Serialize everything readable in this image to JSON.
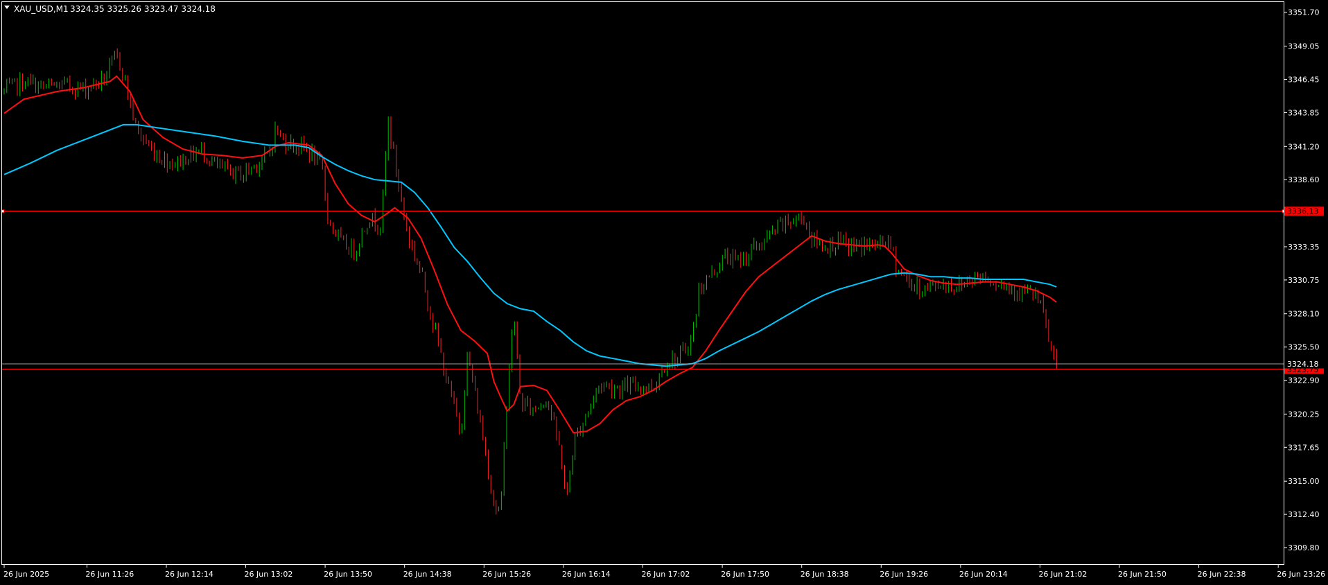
{
  "window": {
    "symbol_label": "XAU_USD,M1",
    "ohlc_label": "3324.35 3325.26 3323.47 3324.18"
  },
  "colors": {
    "background": "#000000",
    "frame": "#ffffff",
    "axis_text": "#ffffff",
    "bull_candle": "#00c000",
    "bear_candle": "#ff2020",
    "ma_fast": "#ff1010",
    "ma_slow": "#00c8ff",
    "level_line": "#ff0000",
    "bid_line": "#a0a0a0",
    "tag_bg": "#ff0000",
    "tag_text": "#000000"
  },
  "chart_data": {
    "type": "candlestick",
    "symbol": "XAU_USD",
    "timeframe": "M1",
    "ylim": [
      3308.5,
      3352.5
    ],
    "y_ticks": [
      "3351.70",
      "3349.05",
      "3346.45",
      "3343.85",
      "3341.20",
      "3338.60",
      "3336.00",
      "3333.35",
      "3330.75",
      "3328.10",
      "3325.50",
      "3322.90",
      "3320.25",
      "3317.65",
      "3315.00",
      "3312.40",
      "3309.80"
    ],
    "x_labels": [
      "26 Jun 2025",
      "26 Jun 11:26",
      "26 Jun 12:14",
      "26 Jun 13:02",
      "26 Jun 13:50",
      "26 Jun 14:38",
      "26 Jun 15:26",
      "26 Jun 16:14",
      "26 Jun 17:02",
      "26 Jun 17:50",
      "26 Jun 18:38",
      "26 Jun 19:26",
      "26 Jun 20:14",
      "26 Jun 21:02",
      "26 Jun 21:50",
      "26 Jun 22:38",
      "26 Jun 23:26"
    ],
    "price_path": [
      [
        0,
        3345.5
      ],
      [
        3,
        3346.3
      ],
      [
        6,
        3345.8
      ],
      [
        9,
        3346.0
      ],
      [
        12,
        3345.7
      ],
      [
        15,
        3346.4
      ],
      [
        17,
        3348.3
      ],
      [
        18,
        3347.0
      ],
      [
        19,
        3344.6
      ],
      [
        20,
        3342.5
      ],
      [
        22,
        3341.1
      ],
      [
        24,
        3340.2
      ],
      [
        26,
        3339.9
      ],
      [
        28,
        3340.5
      ],
      [
        30,
        3340.9
      ],
      [
        32,
        3339.6
      ],
      [
        34,
        3339.2
      ],
      [
        36,
        3339.0
      ],
      [
        38,
        3339.8
      ],
      [
        40,
        3340.5
      ],
      [
        41,
        3342.6
      ],
      [
        42,
        3341.7
      ],
      [
        44,
        3341.3
      ],
      [
        46,
        3340.9
      ],
      [
        48,
        3339.5
      ],
      [
        49,
        3335.4
      ],
      [
        51,
        3333.6
      ],
      [
        53,
        3333.0
      ],
      [
        55,
        3335.6
      ],
      [
        57,
        3335.1
      ],
      [
        58,
        3343.3
      ],
      [
        59,
        3340.0
      ],
      [
        61,
        3334.2
      ],
      [
        63,
        3331.3
      ],
      [
        65,
        3327.0
      ],
      [
        67,
        3322.6
      ],
      [
        69,
        3318.9
      ],
      [
        70,
        3324.9
      ],
      [
        72,
        3319.5
      ],
      [
        74,
        3313.2
      ],
      [
        75,
        3312.4
      ],
      [
        76,
        3322.1
      ],
      [
        77,
        3328.1
      ],
      [
        78,
        3321.1
      ],
      [
        80,
        3320.6
      ],
      [
        82,
        3321.6
      ],
      [
        84,
        3317.4
      ],
      [
        85,
        3313.5
      ],
      [
        86,
        3318.0
      ],
      [
        88,
        3320.3
      ],
      [
        90,
        3322.6
      ],
      [
        93,
        3322.3
      ],
      [
        96,
        3322.5
      ],
      [
        98,
        3322.3
      ],
      [
        100,
        3324.4
      ],
      [
        102,
        3324.6
      ],
      [
        104,
        3326.3
      ],
      [
        105,
        3330.1
      ],
      [
        107,
        3331.3
      ],
      [
        109,
        3332.6
      ],
      [
        111,
        3332.2
      ],
      [
        113,
        3333.1
      ],
      [
        115,
        3333.8
      ],
      [
        117,
        3334.9
      ],
      [
        119,
        3335.4
      ],
      [
        121,
        3335.6
      ],
      [
        122,
        3333.9
      ],
      [
        124,
        3333.4
      ],
      [
        126,
        3333.7
      ],
      [
        128,
        3333.3
      ],
      [
        130,
        3333.5
      ],
      [
        132,
        3333.4
      ],
      [
        133,
        3333.9
      ],
      [
        134,
        3333.2
      ],
      [
        135,
        3331.6
      ],
      [
        136,
        3331.0
      ],
      [
        138,
        3330.0
      ],
      [
        140,
        3330.2
      ],
      [
        142,
        3330.5
      ],
      [
        144,
        3330.2
      ],
      [
        146,
        3330.9
      ],
      [
        148,
        3331.1
      ],
      [
        150,
        3330.6
      ],
      [
        152,
        3330.2
      ],
      [
        154,
        3329.8
      ],
      [
        156,
        3329.5
      ],
      [
        157,
        3328.0
      ],
      [
        158,
        3325.6
      ],
      [
        159,
        3324.18
      ]
    ],
    "series": [
      {
        "name": "",
        "role": "fast moving average",
        "color": "#ff1010",
        "points": [
          [
            0,
            3343.8
          ],
          [
            3,
            3344.9
          ],
          [
            8,
            3345.5
          ],
          [
            12,
            3345.8
          ],
          [
            16,
            3346.3
          ],
          [
            17,
            3346.7
          ],
          [
            19,
            3345.5
          ],
          [
            21,
            3343.3
          ],
          [
            24,
            3341.9
          ],
          [
            27,
            3341.0
          ],
          [
            30,
            3340.6
          ],
          [
            33,
            3340.5
          ],
          [
            36,
            3340.3
          ],
          [
            39,
            3340.5
          ],
          [
            41,
            3341.2
          ],
          [
            43,
            3341.5
          ],
          [
            46,
            3341.3
          ],
          [
            48,
            3340.5
          ],
          [
            50,
            3338.3
          ],
          [
            52,
            3336.7
          ],
          [
            54,
            3335.8
          ],
          [
            56,
            3335.3
          ],
          [
            58,
            3336.0
          ],
          [
            59,
            3336.4
          ],
          [
            61,
            3335.6
          ],
          [
            63,
            3334.0
          ],
          [
            65,
            3331.5
          ],
          [
            67,
            3328.8
          ],
          [
            69,
            3326.8
          ],
          [
            71,
            3326.0
          ],
          [
            73,
            3325.0
          ],
          [
            74,
            3322.8
          ],
          [
            75,
            3321.6
          ],
          [
            76,
            3320.5
          ],
          [
            77,
            3321.0
          ],
          [
            78,
            3322.4
          ],
          [
            80,
            3322.5
          ],
          [
            82,
            3322.1
          ],
          [
            84,
            3320.5
          ],
          [
            86,
            3318.8
          ],
          [
            88,
            3318.9
          ],
          [
            90,
            3319.5
          ],
          [
            92,
            3320.6
          ],
          [
            94,
            3321.3
          ],
          [
            96,
            3321.6
          ],
          [
            98,
            3322.1
          ],
          [
            100,
            3322.8
          ],
          [
            102,
            3323.4
          ],
          [
            104,
            3323.9
          ],
          [
            106,
            3325.2
          ],
          [
            108,
            3326.8
          ],
          [
            110,
            3328.3
          ],
          [
            112,
            3329.8
          ],
          [
            114,
            3331.0
          ],
          [
            116,
            3331.8
          ],
          [
            118,
            3332.6
          ],
          [
            120,
            3333.4
          ],
          [
            122,
            3334.2
          ],
          [
            124,
            3333.8
          ],
          [
            126,
            3333.6
          ],
          [
            128,
            3333.5
          ],
          [
            130,
            3333.4
          ],
          [
            132,
            3333.5
          ],
          [
            133,
            3333.4
          ],
          [
            134,
            3332.9
          ],
          [
            136,
            3331.6
          ],
          [
            138,
            3331.1
          ],
          [
            140,
            3330.7
          ],
          [
            142,
            3330.5
          ],
          [
            144,
            3330.4
          ],
          [
            146,
            3330.5
          ],
          [
            148,
            3330.6
          ],
          [
            150,
            3330.6
          ],
          [
            152,
            3330.4
          ],
          [
            154,
            3330.2
          ],
          [
            156,
            3329.9
          ],
          [
            158,
            3329.4
          ],
          [
            159,
            3329.0
          ]
        ]
      },
      {
        "name": "",
        "role": "slow moving average",
        "color": "#00c8ff",
        "points": [
          [
            0,
            3339.0
          ],
          [
            4,
            3339.9
          ],
          [
            8,
            3340.9
          ],
          [
            12,
            3341.7
          ],
          [
            16,
            3342.5
          ],
          [
            18,
            3342.9
          ],
          [
            20,
            3342.9
          ],
          [
            24,
            3342.6
          ],
          [
            28,
            3342.3
          ],
          [
            32,
            3342.0
          ],
          [
            36,
            3341.6
          ],
          [
            40,
            3341.3
          ],
          [
            44,
            3341.3
          ],
          [
            46,
            3341.1
          ],
          [
            48,
            3340.4
          ],
          [
            50,
            3339.8
          ],
          [
            52,
            3339.3
          ],
          [
            54,
            3338.9
          ],
          [
            56,
            3338.6
          ],
          [
            58,
            3338.5
          ],
          [
            60,
            3338.4
          ],
          [
            62,
            3337.6
          ],
          [
            64,
            3336.4
          ],
          [
            66,
            3334.9
          ],
          [
            68,
            3333.3
          ],
          [
            70,
            3332.2
          ],
          [
            72,
            3330.9
          ],
          [
            74,
            3329.7
          ],
          [
            76,
            3328.9
          ],
          [
            78,
            3328.5
          ],
          [
            80,
            3328.3
          ],
          [
            82,
            3327.5
          ],
          [
            84,
            3326.8
          ],
          [
            86,
            3325.9
          ],
          [
            88,
            3325.2
          ],
          [
            90,
            3324.8
          ],
          [
            92,
            3324.6
          ],
          [
            94,
            3324.4
          ],
          [
            96,
            3324.2
          ],
          [
            98,
            3324.1
          ],
          [
            100,
            3324.0
          ],
          [
            102,
            3324.1
          ],
          [
            104,
            3324.2
          ],
          [
            106,
            3324.6
          ],
          [
            108,
            3325.2
          ],
          [
            110,
            3325.7
          ],
          [
            112,
            3326.2
          ],
          [
            114,
            3326.7
          ],
          [
            116,
            3327.3
          ],
          [
            118,
            3327.9
          ],
          [
            120,
            3328.5
          ],
          [
            122,
            3329.1
          ],
          [
            124,
            3329.6
          ],
          [
            126,
            3330.0
          ],
          [
            128,
            3330.3
          ],
          [
            130,
            3330.6
          ],
          [
            132,
            3330.9
          ],
          [
            134,
            3331.2
          ],
          [
            136,
            3331.3
          ],
          [
            138,
            3331.2
          ],
          [
            140,
            3331.0
          ],
          [
            142,
            3331.0
          ],
          [
            144,
            3330.9
          ],
          [
            146,
            3330.9
          ],
          [
            148,
            3330.8
          ],
          [
            150,
            3330.8
          ],
          [
            152,
            3330.8
          ],
          [
            154,
            3330.8
          ],
          [
            156,
            3330.6
          ],
          [
            158,
            3330.4
          ],
          [
            159,
            3330.2
          ]
        ]
      }
    ],
    "hlines": [
      {
        "price": 3336.13,
        "label": "3336.13",
        "color": "#ff0000",
        "kind": "level"
      },
      {
        "price": 3323.75,
        "label": "3323.75",
        "color": "#ff0000",
        "kind": "level"
      },
      {
        "price": 3324.18,
        "label": "3324.18",
        "color": "#a0a0a0",
        "kind": "bid"
      }
    ],
    "grid": false,
    "legend": "none"
  }
}
